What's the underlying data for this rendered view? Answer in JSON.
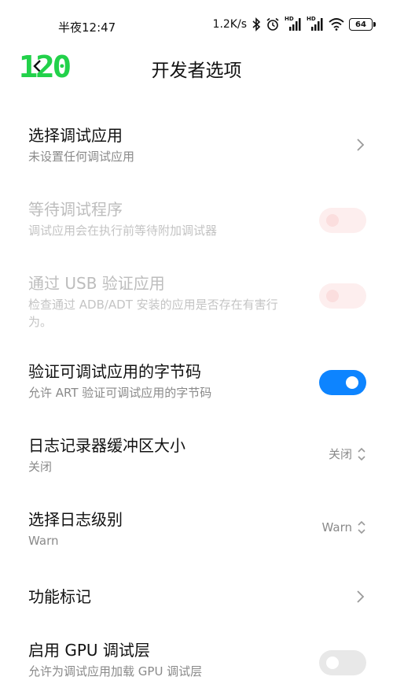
{
  "status_bar": {
    "time": "半夜12:47",
    "speed": "1.2K/s",
    "hd1": "HD",
    "hd2": "HD",
    "battery": "64"
  },
  "header": {
    "fps_badge": "120",
    "title": "开发者选项"
  },
  "settings": [
    {
      "title": "选择调试应用",
      "summary": "未设置任何调试应用",
      "control": "chevron",
      "enabled": true
    },
    {
      "title": "等待调试程序",
      "summary": "调试应用会在执行前等待附加调试器",
      "control": "toggle",
      "state": "off",
      "enabled": false
    },
    {
      "title": "通过 USB 验证应用",
      "summary": "检查通过 ADB/ADT 安装的应用是否存在有害行为。",
      "control": "toggle",
      "state": "off",
      "enabled": false
    },
    {
      "title": "验证可调试应用的字节码",
      "summary": "允许 ART 验证可调试应用的字节码",
      "control": "toggle",
      "state": "on",
      "enabled": true
    },
    {
      "title": "日志记录器缓冲区大小",
      "summary": "关闭",
      "control": "select",
      "value": "关闭",
      "enabled": true
    },
    {
      "title": "选择日志级别",
      "summary": "Warn",
      "control": "select",
      "value": "Warn",
      "enabled": true
    },
    {
      "title": "功能标记",
      "summary": "",
      "control": "chevron",
      "enabled": true
    },
    {
      "title": "启用 GPU 调试层",
      "summary": "允许为调试应用加载 GPU 调试层",
      "control": "toggle",
      "state": "off",
      "enabled": true
    }
  ],
  "colors": {
    "accent": "#0d84ff",
    "fps_badge": "#22d14a",
    "disabled_text": "#bdbdbd"
  }
}
